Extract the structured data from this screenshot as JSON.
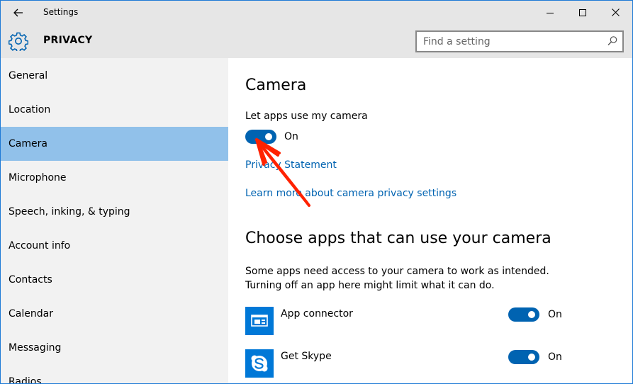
{
  "window": {
    "title": "Settings"
  },
  "header": {
    "section": "PRIVACY",
    "search_placeholder": "Find a setting"
  },
  "sidebar": {
    "items": [
      {
        "label": "General"
      },
      {
        "label": "Location"
      },
      {
        "label": "Camera",
        "selected": true
      },
      {
        "label": "Microphone"
      },
      {
        "label": "Speech, inking, & typing"
      },
      {
        "label": "Account info"
      },
      {
        "label": "Contacts"
      },
      {
        "label": "Calendar"
      },
      {
        "label": "Messaging"
      },
      {
        "label": "Radios"
      }
    ]
  },
  "main": {
    "heading": "Camera",
    "toggle_label": "Let apps use my camera",
    "toggle_state": "On",
    "links": {
      "privacy_statement": "Privacy Statement",
      "learn_more": "Learn more about camera privacy settings"
    },
    "apps_heading": "Choose apps that can use your camera",
    "apps_desc_line1": "Some apps need access to your camera to work as intended.",
    "apps_desc_line2": "Turning off an app here might limit what it can do.",
    "apps": [
      {
        "name": "App connector",
        "state": "On",
        "icon": "app-connector-icon"
      },
      {
        "name": "Get Skype",
        "state": "On",
        "icon": "skype-icon"
      }
    ]
  },
  "colors": {
    "accent": "#0063b1",
    "selection": "#91c1ea",
    "sidebar_bg": "#f2f2f2",
    "header_bg": "#e6e6e6",
    "skype": "#00aff0",
    "annotation": "#ff2200"
  }
}
